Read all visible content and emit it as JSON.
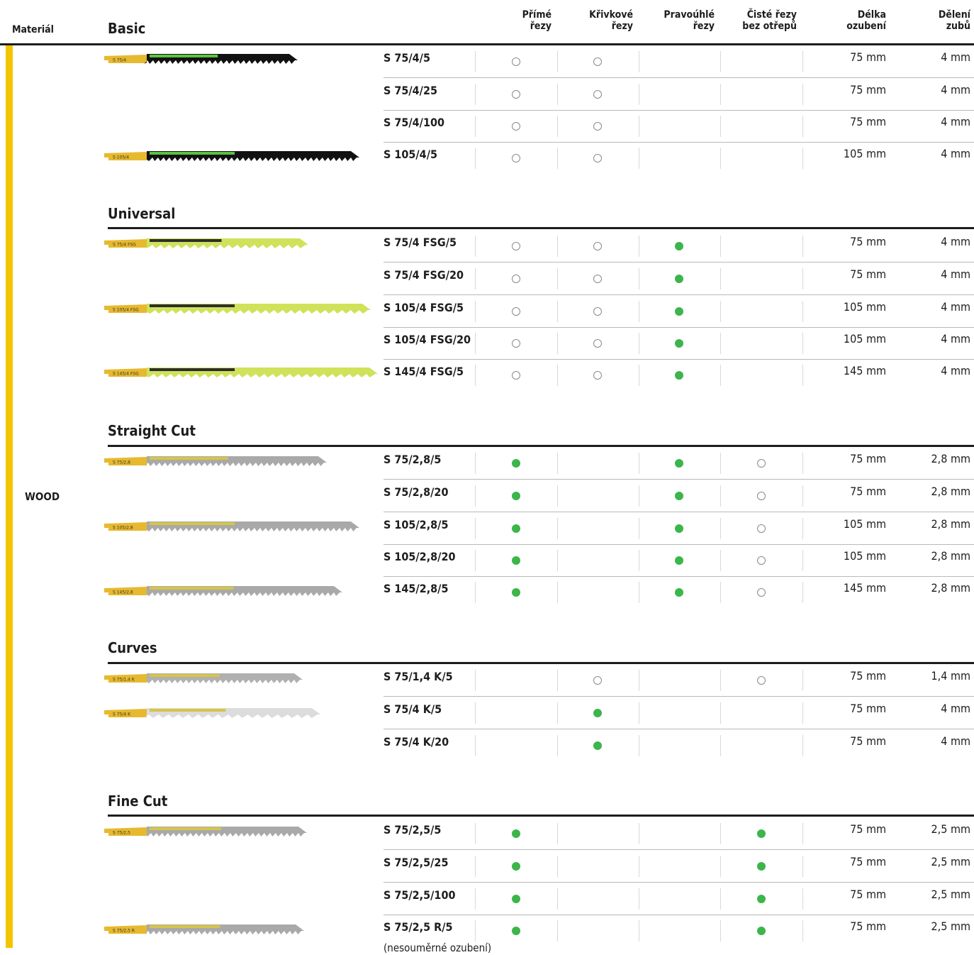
{
  "header": {
    "material": "Materiál",
    "first_group": "Basic",
    "col_straight": [
      "Přímé",
      "řezy"
    ],
    "col_curve": [
      "Křivkové",
      "řezy"
    ],
    "col_square": [
      "Pravoúhlé",
      "řezy"
    ],
    "col_clean": [
      "Čisté řezy",
      "bez otřepů"
    ],
    "col_length": [
      "Délka",
      "ozubení"
    ],
    "col_pitch": [
      "Dělení",
      "zubů"
    ]
  },
  "material_value": "WOOD",
  "groups": [
    "Basic",
    "Universal",
    "Straight Cut",
    "Curves",
    "Fine Cut"
  ],
  "rows": [
    {
      "code": "S 75/4/5",
      "straight": "optional",
      "curve": "optional",
      "square": "",
      "clean": "",
      "length": "75 mm",
      "pitch": "4 mm"
    },
    {
      "code": "S 75/4/25",
      "straight": "optional",
      "curve": "optional",
      "square": "",
      "clean": "",
      "length": "75 mm",
      "pitch": "4 mm"
    },
    {
      "code": "S 75/4/100",
      "straight": "optional",
      "curve": "optional",
      "square": "",
      "clean": "",
      "length": "75 mm",
      "pitch": "4 mm"
    },
    {
      "code": "S 105/4/5",
      "straight": "optional",
      "curve": "optional",
      "square": "",
      "clean": "",
      "length": "105 mm",
      "pitch": "4 mm"
    },
    {
      "code": "S 75/4 FSG/5",
      "straight": "optional",
      "curve": "optional",
      "square": "recommended",
      "clean": "",
      "length": "75 mm",
      "pitch": "4 mm"
    },
    {
      "code": "S 75/4 FSG/20",
      "straight": "optional",
      "curve": "optional",
      "square": "recommended",
      "clean": "",
      "length": "75 mm",
      "pitch": "4 mm"
    },
    {
      "code": "S 105/4 FSG/5",
      "straight": "optional",
      "curve": "optional",
      "square": "recommended",
      "clean": "",
      "length": "105 mm",
      "pitch": "4 mm"
    },
    {
      "code": "S 105/4 FSG/20",
      "straight": "optional",
      "curve": "optional",
      "square": "recommended",
      "clean": "",
      "length": "105 mm",
      "pitch": "4 mm"
    },
    {
      "code": "S 145/4 FSG/5",
      "straight": "optional",
      "curve": "optional",
      "square": "recommended",
      "clean": "",
      "length": "145 mm",
      "pitch": "4 mm"
    },
    {
      "code": "S 75/2,8/5",
      "straight": "recommended",
      "curve": "",
      "square": "recommended",
      "clean": "optional",
      "length": "75 mm",
      "pitch": "2,8 mm"
    },
    {
      "code": "S 75/2,8/20",
      "straight": "recommended",
      "curve": "",
      "square": "recommended",
      "clean": "optional",
      "length": "75 mm",
      "pitch": "2,8 mm"
    },
    {
      "code": "S 105/2,8/5",
      "straight": "recommended",
      "curve": "",
      "square": "recommended",
      "clean": "optional",
      "length": "105 mm",
      "pitch": "2,8 mm"
    },
    {
      "code": "S 105/2,8/20",
      "straight": "recommended",
      "curve": "",
      "square": "recommended",
      "clean": "optional",
      "length": "105 mm",
      "pitch": "2,8 mm"
    },
    {
      "code": "S 145/2,8/5",
      "straight": "recommended",
      "curve": "",
      "square": "recommended",
      "clean": "optional",
      "length": "145 mm",
      "pitch": "2,8 mm"
    },
    {
      "code": "S 75/1,4 K/5",
      "straight": "",
      "curve": "optional",
      "square": "",
      "clean": "optional",
      "length": "75 mm",
      "pitch": "1,4 mm"
    },
    {
      "code": "S 75/4 K/5",
      "straight": "",
      "curve": "recommended",
      "square": "",
      "clean": "",
      "length": "75 mm",
      "pitch": "4 mm"
    },
    {
      "code": "S 75/4 K/20",
      "straight": "",
      "curve": "recommended",
      "square": "",
      "clean": "",
      "length": "75 mm",
      "pitch": "4 mm"
    },
    {
      "code": "S 75/2,5/5",
      "straight": "recommended",
      "curve": "",
      "square": "",
      "clean": "recommended",
      "length": "75 mm",
      "pitch": "2,5 mm"
    },
    {
      "code": "S 75/2,5/25",
      "straight": "recommended",
      "curve": "",
      "square": "",
      "clean": "recommended",
      "length": "75 mm",
      "pitch": "2,5 mm"
    },
    {
      "code": "S 75/2,5/100",
      "straight": "recommended",
      "curve": "",
      "square": "",
      "clean": "recommended",
      "length": "75 mm",
      "pitch": "2,5 mm"
    },
    {
      "code": "S 75/2,5 R/5",
      "straight": "recommended",
      "curve": "",
      "square": "",
      "clean": "recommended",
      "length": "75 mm",
      "pitch": "2,5 mm"
    }
  ],
  "note": "(nesouměrné ozubení)",
  "blade_labels": [
    "S 75/4",
    "S 105/4",
    "S 75/4 FSG",
    "S 105/4 FSG",
    "S 145/4 FSG",
    "S 75/2,8",
    "S 105/2,8",
    "S 145/2,8",
    "S 75/1,4 K",
    "S 75/4 K",
    "S 75/2,5",
    "S 75/2,5 R"
  ],
  "colors": {
    "accent_yellow": "#f5c400",
    "recommended_green": "#3cb54a",
    "rule": "#1d1d1b"
  },
  "icons": {
    "recommended": "filled-green-dot",
    "optional": "hollow-circle"
  }
}
